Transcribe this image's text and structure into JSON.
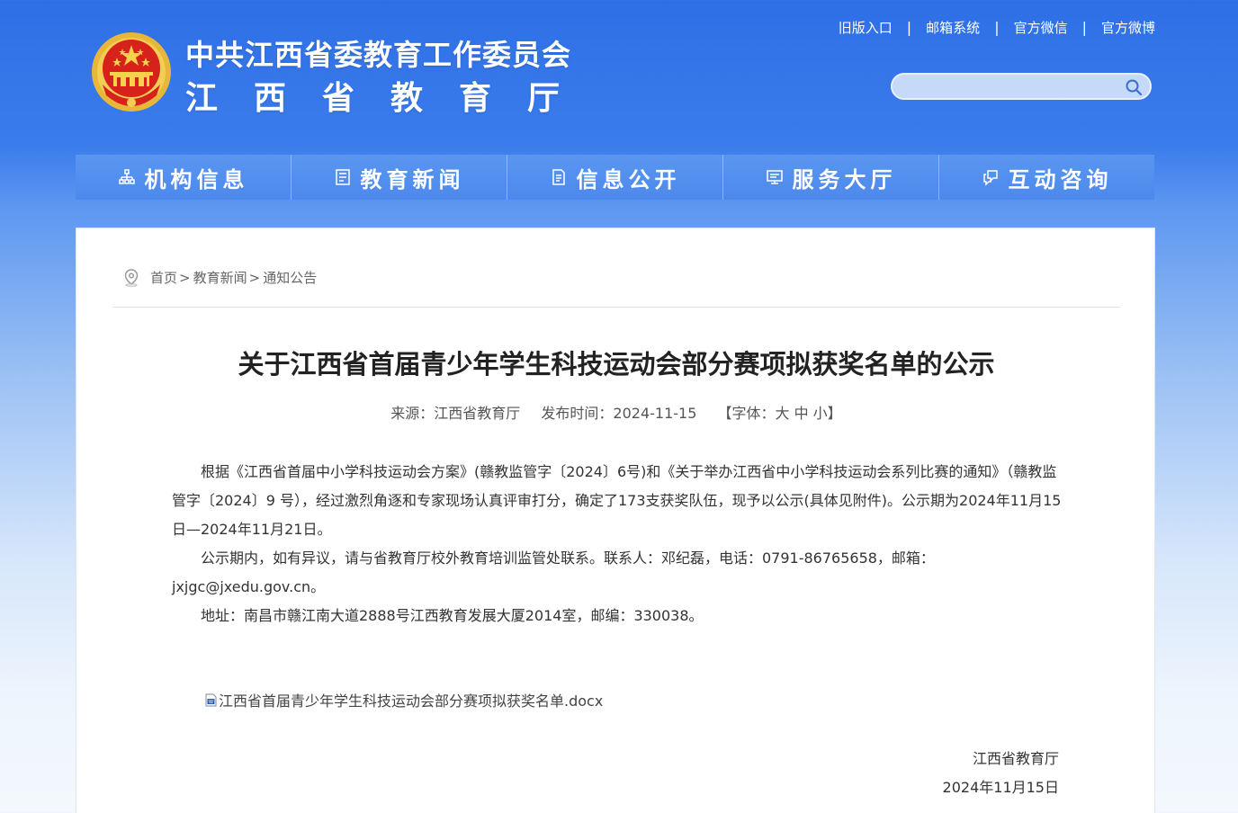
{
  "header": {
    "emblem_icon": "national-emblem-icon",
    "title_line1": "中共江西省委教育工作委员会",
    "title_line2": "江西省教育厅",
    "top_links": [
      "旧版入口",
      "邮箱系统",
      "官方微信",
      "官方微博"
    ],
    "search": {
      "placeholder": "",
      "icon": "search-icon"
    }
  },
  "nav": {
    "items": [
      {
        "label": "机构信息",
        "icon": "org-tree-icon"
      },
      {
        "label": "教育新闻",
        "icon": "news-icon"
      },
      {
        "label": "信息公开",
        "icon": "document-icon"
      },
      {
        "label": "服务大厅",
        "icon": "service-monitor-icon"
      },
      {
        "label": "互动咨询",
        "icon": "chat-bubbles-icon"
      }
    ]
  },
  "breadcrumb": {
    "icon": "location-pin-icon",
    "items": [
      "首页",
      "教育新闻",
      "通知公告"
    ],
    "separator": ">"
  },
  "article": {
    "title": "关于江西省首届青少年学生科技运动会部分赛项拟获奖名单的公示",
    "source": "来源：江西省教育厅",
    "publish_time": "发布时间：2024-11-15",
    "font_size_control": "【字体：大 中 小】",
    "paragraphs": [
      "根据《江西省首届中小学科技运动会方案》(赣教监管字〔2024〕6号)和《关于举办江西省中小学科技运动会系列比赛的通知》（赣教监管字〔2024〕9 号），经过激烈角逐和专家现场认真评审打分，确定了173支获奖队伍，现予以公示(具体见附件)。公示期为2024年11月15日—2024年11月21日。",
      "公示期内，如有异议，请与省教育厅校外教育培训监管处联系。联系人：邓纪磊，电话：0791-86765658，邮箱：jxjgc@jxedu.gov.cn。",
      "地址：南昌市赣江南大道2888号江西教育发展大厦2014室，邮编：330038。"
    ],
    "attachment": {
      "icon": "word-doc-icon",
      "name": "江西省首届青少年学生科技运动会部分赛项拟获奖名单.docx"
    },
    "signature": {
      "org": "江西省教育厅",
      "date": "2024年11月15日"
    }
  }
}
